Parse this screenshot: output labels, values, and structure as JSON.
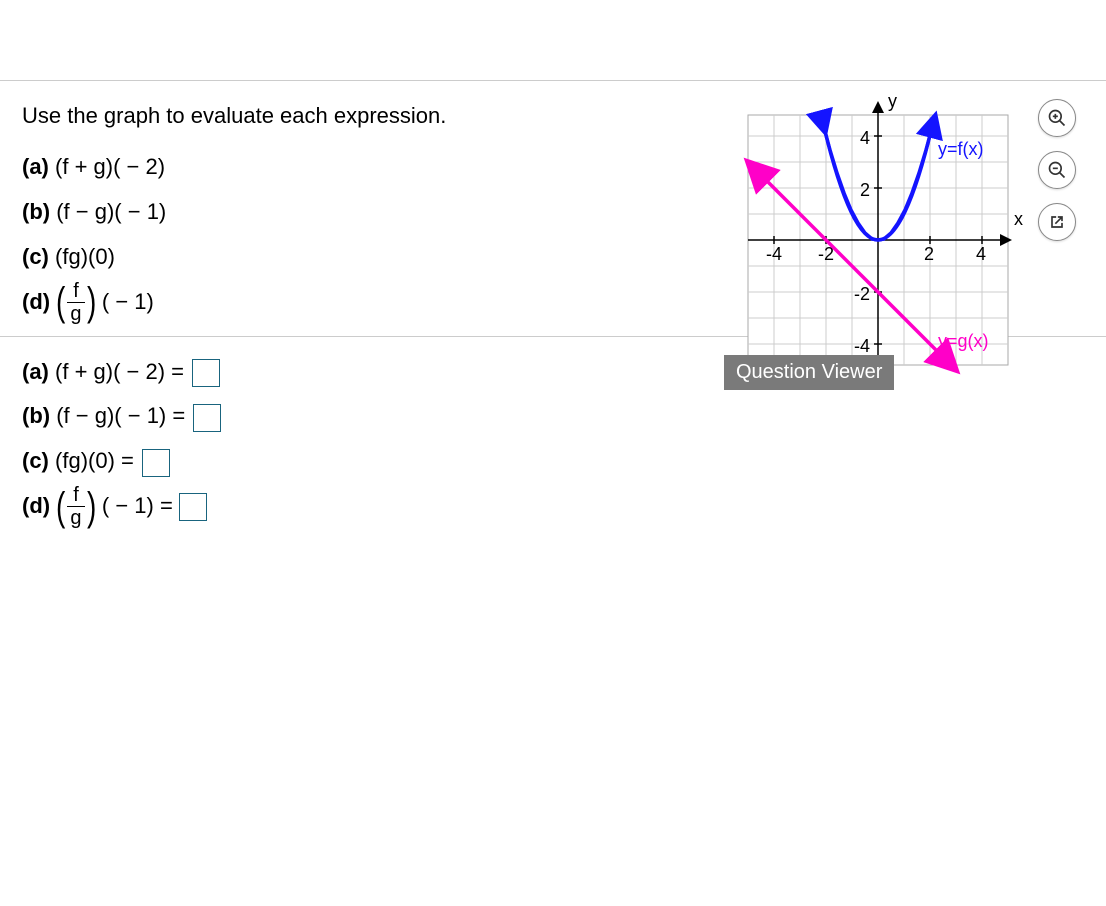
{
  "instruction": "Use the graph to evaluate each expression.",
  "parts": {
    "a_label": "(a)",
    "a_expr": "(f + g)( − 2)",
    "b_label": "(b)",
    "b_expr": "(f − g)( − 1)",
    "c_label": "(c)",
    "c_expr": "(fg)(0)",
    "d_label": "(d)",
    "d_frac_num": "f",
    "d_frac_den": "g",
    "d_tail": "( − 1)"
  },
  "answers": {
    "a": "(f + g)( − 2) =",
    "b": "(f − g)( − 1) =",
    "c": "(fg)(0) =",
    "d_tail": "( − 1) ="
  },
  "graph": {
    "y_label": "y",
    "x_label": "x",
    "f_label": "y=f(x)",
    "g_label": "y=g(x)",
    "ticks": {
      "neg4": "-4",
      "neg2": "-2",
      "pos2": "2",
      "pos4": "4"
    },
    "ytick": {
      "p4": "4",
      "p2": "2",
      "n2": "-2",
      "n4": "-4"
    }
  },
  "question_viewer": "Question Viewer",
  "chart_data": {
    "type": "line",
    "title": "",
    "xlabel": "x",
    "ylabel": "y",
    "xlim": [
      -5,
      5
    ],
    "ylim": [
      -5,
      5
    ],
    "series": [
      {
        "name": "y=f(x)",
        "color": "#1414ff",
        "type": "parabola",
        "equation": "y = x^2",
        "x": [
          -2,
          -1,
          0,
          1,
          2
        ],
        "y": [
          4,
          1,
          0,
          1,
          4
        ]
      },
      {
        "name": "y=g(x)",
        "color": "#ff00c8",
        "type": "line",
        "equation": "y = -x - 2",
        "x": [
          -5,
          3
        ],
        "y": [
          3,
          -5
        ]
      }
    ],
    "annotations": [
      {
        "text": "y=f(x)",
        "x": 2.3,
        "y": 3.3,
        "color": "#1414ff"
      },
      {
        "text": "y=g(x)",
        "x": 2.3,
        "y": -4.2,
        "color": "#ff00c8"
      }
    ]
  }
}
